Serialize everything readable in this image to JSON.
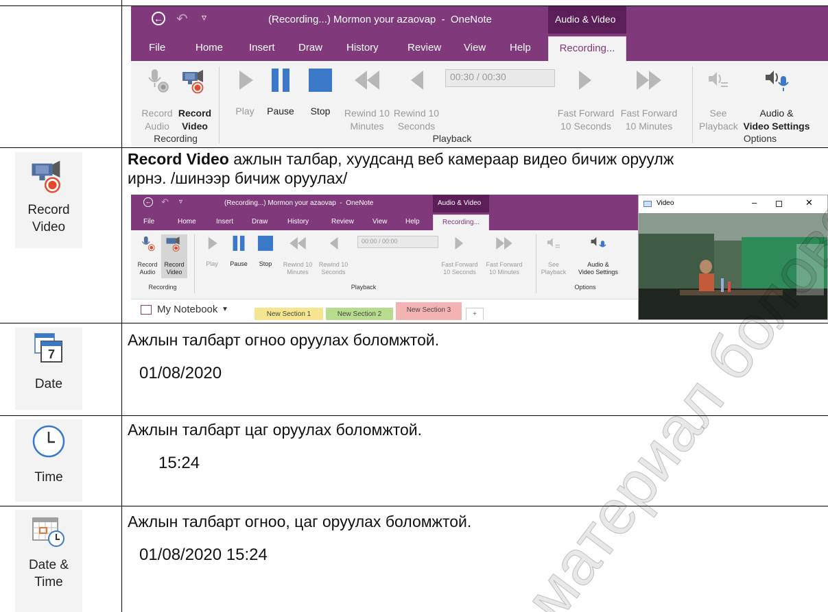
{
  "ribbon": {
    "title": "(Recording...) Mormon your azaovap  -  OneNote",
    "context_tab": "Audio & Video",
    "tabs": [
      "File",
      "Home",
      "Insert",
      "Draw",
      "History",
      "Review",
      "View",
      "Help",
      "Recording..."
    ],
    "time_display": "00:30 / 00:30",
    "buttons": {
      "record_audio": [
        "Record",
        "Audio"
      ],
      "record_video": [
        "Record",
        "Video"
      ],
      "play": "Play",
      "pause": "Pause",
      "stop": "Stop",
      "rewind10m": [
        "Rewind 10",
        "Minutes"
      ],
      "rewind10s": [
        "Rewind 10",
        "Seconds"
      ],
      "ff10s": [
        "Fast Forward",
        "10 Seconds"
      ],
      "ff10m": [
        "Fast Forward",
        "10 Minutes"
      ],
      "see_playback": [
        "See",
        "Playback"
      ],
      "av_settings": [
        "Audio &",
        "Video Settings"
      ]
    },
    "groups": {
      "recording": "Recording",
      "playback": "Playback",
      "options": "Options"
    }
  },
  "small_ribbon": {
    "time_display": "00:00 / 00:00",
    "notebook": "My Notebook",
    "sections": [
      "New Section 1",
      "New Section 2",
      "New Section 3",
      "+"
    ],
    "video_window_title": "Video"
  },
  "rows": [
    {
      "icon": "record-video-icon",
      "label_lines": [
        "Record",
        "Video"
      ],
      "desc_bold": "Record Video",
      "desc_rest": " ажлын талбар, хуудсанд веб камераар видео бичиж оруулж",
      "desc_line2": "ирнэ. /шинээр бичиж оруулах/"
    },
    {
      "icon": "calendar-icon",
      "label_lines": [
        "Date"
      ],
      "calendar_number": "7",
      "desc": "Ажлын талбарт огноо оруулах боломжтой.",
      "example": "01/08/2020"
    },
    {
      "icon": "clock-icon",
      "label_lines": [
        "Time"
      ],
      "desc": "Ажлын талбарт цаг оруулах боломжтой.",
      "example": "15:24"
    },
    {
      "icon": "date-time-icon",
      "label_lines": [
        "Date &",
        "Time"
      ],
      "desc": "Ажлын талбарт огноо, цаг оруулах боломжтой.",
      "example": "01/08/2020 15:24"
    }
  ],
  "watermark": "материал боловсруулах ар",
  "colors": {
    "onenote_purple": "#80397b",
    "context_purple": "#5b1e58",
    "accent_blue": "#3c78c8",
    "record_red": "#e34a2c"
  }
}
